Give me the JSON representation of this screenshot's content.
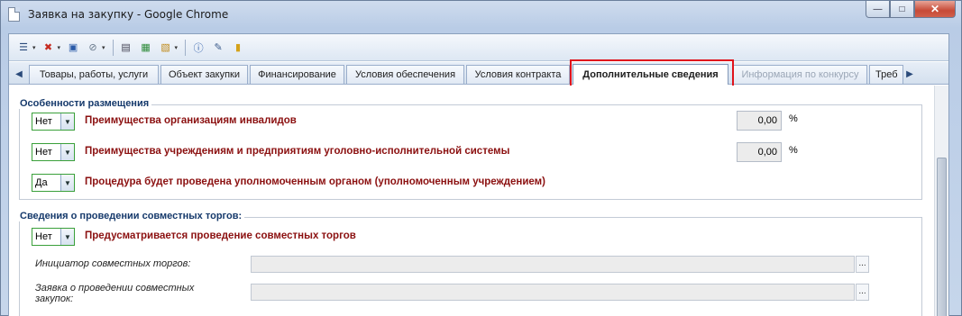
{
  "window": {
    "title": "Заявка на закупку - Google Chrome",
    "controls": {
      "minimize": "—",
      "maximize": "□",
      "close": "✕"
    }
  },
  "toolbar": {
    "items": [
      {
        "name": "actions-menu-icon",
        "glyph": "☰",
        "color": "#2a4a7a",
        "caret": "▾"
      },
      {
        "name": "cancel-icon",
        "glyph": "✖",
        "color": "#c62a1f",
        "caret": "▾"
      },
      {
        "name": "save-icon",
        "glyph": "▣",
        "color": "#2a5aa8"
      },
      {
        "name": "attach-icon",
        "glyph": "⊘",
        "color": "#6a7a8c",
        "caret": "▾"
      },
      {
        "name": "print-icon",
        "glyph": "▤",
        "color": "#445"
      },
      {
        "name": "document-export-icon",
        "glyph": "▦",
        "color": "#2e8b3a"
      },
      {
        "name": "document-edit-icon",
        "glyph": "▧",
        "color": "#c08a1a",
        "caret": "▾"
      },
      {
        "name": "info-icon",
        "glyph": "ⓘ",
        "color": "#2a5aa8"
      },
      {
        "name": "tools-icon",
        "glyph": "✎",
        "color": "#3a5a8a"
      },
      {
        "name": "archive-icon",
        "glyph": "▮",
        "color": "#d4a21a"
      }
    ]
  },
  "tabs": {
    "left_arrow": "◀",
    "right_arrow": "▶",
    "items": [
      {
        "label": "Товары, работы, услуги",
        "state": "normal"
      },
      {
        "label": "Объект закупки",
        "state": "normal"
      },
      {
        "label": "Финансирование",
        "state": "normal"
      },
      {
        "label": "Условия обеспечения",
        "state": "normal"
      },
      {
        "label": "Условия контракта",
        "state": "normal"
      },
      {
        "label": "Дополнительные сведения",
        "state": "active"
      },
      {
        "label": "Информация по конкурсу",
        "state": "disabled"
      },
      {
        "label": "Треб",
        "state": "normal"
      }
    ]
  },
  "placement": {
    "title": "Особенности размещения",
    "rows": [
      {
        "value": "Нет",
        "label": "Преимущества организациям инвалидов",
        "percent": "0,00",
        "unit": "%"
      },
      {
        "value": "Нет",
        "label": "Преимущества учреждениям и предприятиям уголовно-исполнительной системы",
        "percent": "0,00",
        "unit": "%"
      },
      {
        "value": "Да",
        "label": "Процедура будет проведена уполномоченным органом (уполномоченным учреждением)"
      }
    ]
  },
  "joint": {
    "title": "Сведения о проведении совместных торгов:",
    "value": "Нет",
    "label": "Предусматривается проведение совместных торгов",
    "initiator_label": "Инициатор совместных торгов:",
    "initiator_value": "",
    "request_label": "Заявка о проведении совместных закупок:",
    "request_value": "",
    "lookup_button": "..."
  },
  "colors": {
    "label_red": "#8b1010",
    "group_title": "#15396b",
    "highlight_border": "#e0141c",
    "dropdown_border": "#3aa03a"
  }
}
